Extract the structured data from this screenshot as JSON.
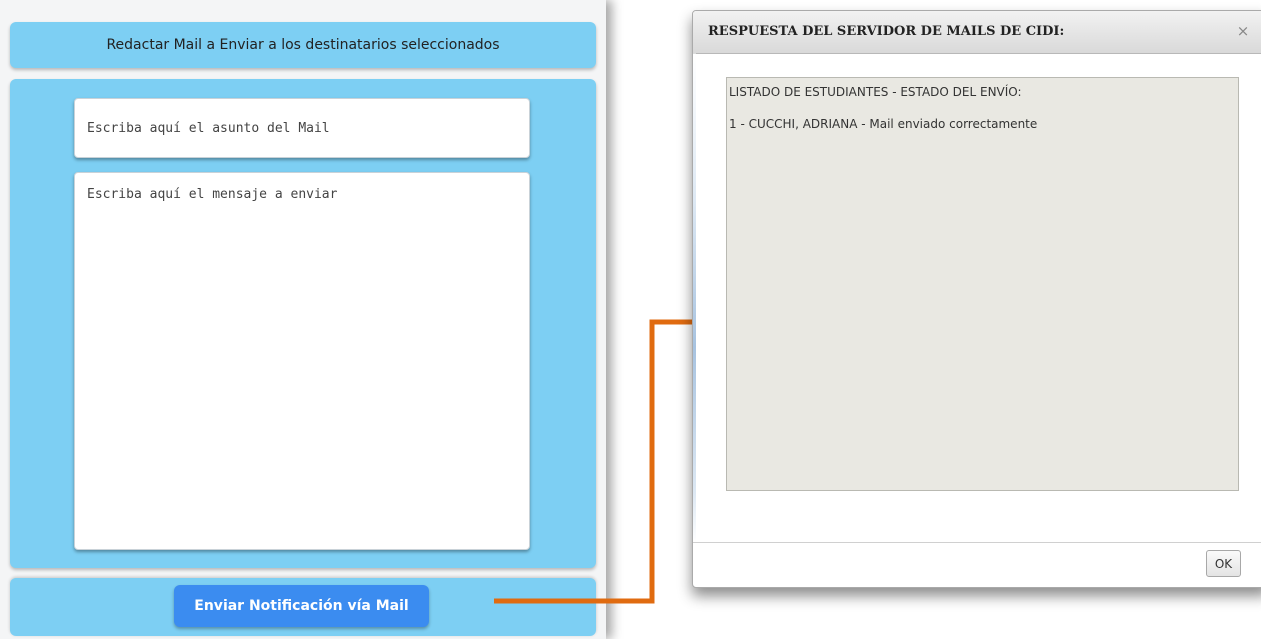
{
  "compose": {
    "header": "Redactar Mail a Enviar a los destinatarios seleccionados",
    "subject_placeholder": "Escriba aquí el asunto del Mail",
    "message_placeholder": "Escriba aquí el mensaje a enviar",
    "send_label": "Enviar Notificación vía Mail"
  },
  "dialog": {
    "title": "RESPUESTA DEL SERVIDOR DE MAILS DE CIDI:",
    "close_glyph": "×",
    "lines": [
      "LISTADO DE ESTUDIANTES - ESTADO DEL ENVÍO:",
      "1 - CUCCHI, ADRIANA - Mail enviado correctamente"
    ],
    "ok_label": "OK"
  },
  "colors": {
    "panel_blue": "#7dcff3",
    "button_blue": "#3b8cf0",
    "arrow_orange": "#e06b10",
    "output_bg": "#e9e8e2"
  },
  "icons": {
    "close": "close-icon",
    "arrow": "arrow-right-icon"
  }
}
